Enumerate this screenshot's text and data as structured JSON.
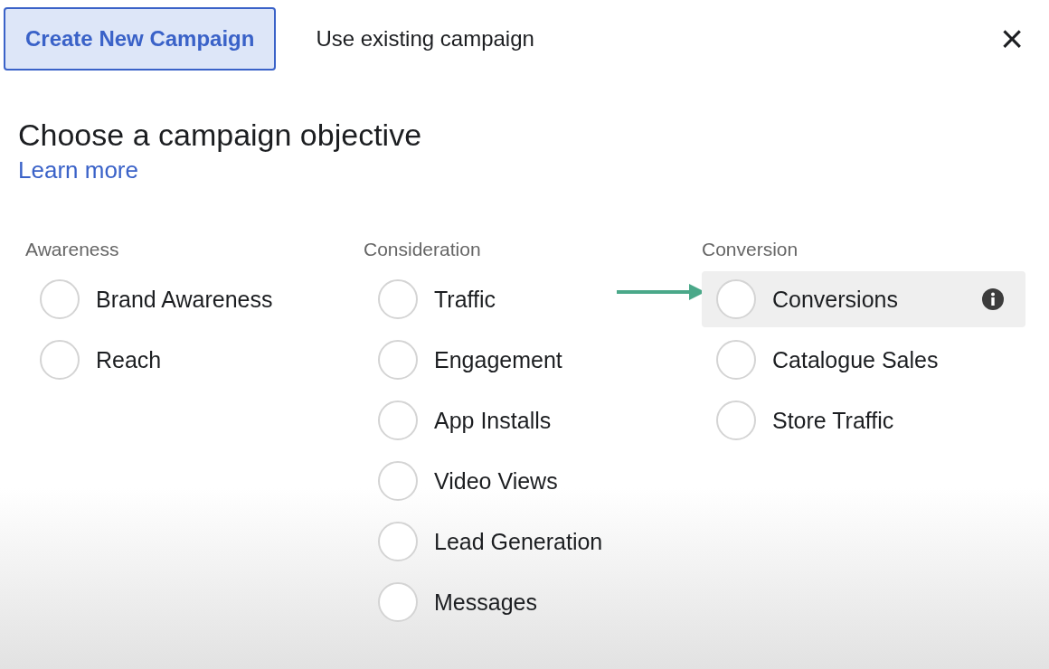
{
  "tabs": [
    {
      "label": "Create New Campaign",
      "selected": true
    },
    {
      "label": "Use existing campaign",
      "selected": false
    }
  ],
  "close": "×",
  "heading": "Choose a campaign objective",
  "learn_more": "Learn more",
  "columns": [
    {
      "heading": "Awareness",
      "options": [
        {
          "label": "Brand Awareness",
          "selected": false,
          "highlighted": false,
          "info": false
        },
        {
          "label": "Reach",
          "selected": false,
          "highlighted": false,
          "info": false
        }
      ]
    },
    {
      "heading": "Consideration",
      "options": [
        {
          "label": "Traffic",
          "selected": false,
          "highlighted": false,
          "info": false
        },
        {
          "label": "Engagement",
          "selected": false,
          "highlighted": false,
          "info": false
        },
        {
          "label": "App Installs",
          "selected": false,
          "highlighted": false,
          "info": false
        },
        {
          "label": "Video Views",
          "selected": false,
          "highlighted": false,
          "info": false
        },
        {
          "label": "Lead Generation",
          "selected": false,
          "highlighted": false,
          "info": false
        },
        {
          "label": "Messages",
          "selected": false,
          "highlighted": false,
          "info": false
        }
      ]
    },
    {
      "heading": "Conversion",
      "options": [
        {
          "label": "Conversions",
          "selected": false,
          "highlighted": true,
          "info": true
        },
        {
          "label": "Catalogue Sales",
          "selected": false,
          "highlighted": false,
          "info": false
        },
        {
          "label": "Store Traffic",
          "selected": false,
          "highlighted": false,
          "info": false
        }
      ]
    }
  ]
}
